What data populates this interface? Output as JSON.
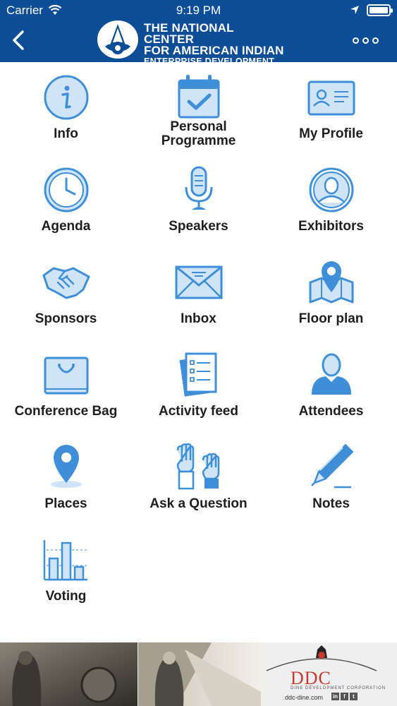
{
  "status_bar": {
    "carrier": "Carrier",
    "time": "9:19 PM"
  },
  "header": {
    "brand_line1": "THE NATIONAL CENTER",
    "brand_line2": "FOR AMERICAN INDIAN",
    "brand_line3": "ENTERPRISE DEVELOPMENT",
    "background": "#0c4d98"
  },
  "menu": {
    "icon_color": "#3f8fd8",
    "icon_fill": "#cfe4f7",
    "items": [
      {
        "label": "Info",
        "icon": "info-icon"
      },
      {
        "label": "Personal\nProgramme",
        "icon": "calendar-check-icon"
      },
      {
        "label": "My Profile",
        "icon": "id-card-icon"
      },
      {
        "label": "Agenda",
        "icon": "clock-icon"
      },
      {
        "label": "Speakers",
        "icon": "microphone-icon"
      },
      {
        "label": "Exhibitors",
        "icon": "person-circle-icon"
      },
      {
        "label": "Sponsors",
        "icon": "handshake-icon"
      },
      {
        "label": "Inbox",
        "icon": "envelope-icon"
      },
      {
        "label": "Floor plan",
        "icon": "map-pin-icon"
      },
      {
        "label": "Conference Bag",
        "icon": "bag-icon"
      },
      {
        "label": "Activity feed",
        "icon": "documents-icon"
      },
      {
        "label": "Attendees",
        "icon": "person-icon"
      },
      {
        "label": "Places",
        "icon": "location-pin-icon"
      },
      {
        "label": "Ask a Question",
        "icon": "raised-hands-icon"
      },
      {
        "label": "Notes",
        "icon": "pen-icon"
      },
      {
        "label": "Voting",
        "icon": "bar-chart-icon"
      }
    ]
  },
  "banner": {
    "company": "DDC",
    "company_full": "DINE DEVELOPMENT CORPORATION",
    "url": "ddc-dine.com",
    "social": [
      "in",
      "f",
      "t"
    ]
  }
}
